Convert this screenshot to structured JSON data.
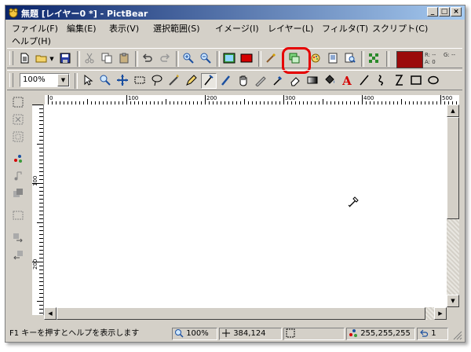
{
  "window": {
    "title": "無題 [レイヤー0 *] - PictBear",
    "controls": {
      "minimize": "_",
      "maximize": "□",
      "close": "×"
    }
  },
  "menu": [
    "ファイル(F)",
    "編集(E)",
    "表示(V)",
    "選択範囲(S)",
    "イメージ(I)",
    "レイヤー(L)",
    "フィルタ(T)",
    "スクリプト(C)",
    "ヘルプ(H)"
  ],
  "toolbar1": {
    "color_swatch": "#9b0a0a",
    "readout": {
      "r": "R: --",
      "a": "A: 0",
      "g": "G: --"
    }
  },
  "toolbar2": {
    "zoom_value": "100%"
  },
  "ruler": {
    "h_labels": [
      "0",
      "100",
      "200",
      "300",
      "400",
      "500"
    ],
    "v_labels": [
      "100",
      "200"
    ]
  },
  "status": {
    "help": "F1 キーを押すとヘルプを表示します",
    "zoom": "100%",
    "position": "384,124",
    "color": "255,255,255",
    "undo": "1"
  },
  "colors": {
    "title_start": "#0a246a",
    "title_end": "#a6caf0",
    "highlight": "#e60000",
    "face": "#d4d0c8"
  }
}
